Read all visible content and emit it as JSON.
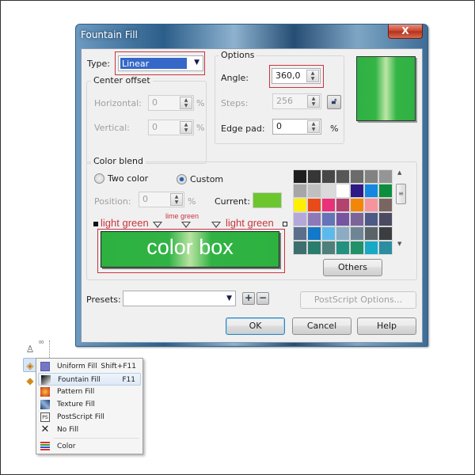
{
  "dialog": {
    "title": "Fountain Fill",
    "close_label": "X",
    "type": {
      "label": "Type:",
      "value": "Linear"
    },
    "center_offset": {
      "title": "Center offset",
      "horizontal": {
        "label": "Horizontal:",
        "value": "0",
        "unit": "%"
      },
      "vertical": {
        "label": "Vertical:",
        "value": "0",
        "unit": "%"
      }
    },
    "options": {
      "title": "Options",
      "angle": {
        "label": "Angle:",
        "value": "360,0"
      },
      "steps": {
        "label": "Steps:",
        "value": "256"
      },
      "edge_pad": {
        "label": "Edge pad:",
        "value": "0",
        "unit": "%"
      }
    },
    "color_blend": {
      "title": "Color blend",
      "two_color_label": "Two color",
      "custom_label": "Custom",
      "selected_mode": "Custom",
      "position": {
        "label": "Position:",
        "value": "0",
        "unit": "%"
      },
      "current_label": "Current:",
      "current_color": "#6cc72e",
      "annotations": {
        "left": "light green",
        "middle": "lime green",
        "right": "light green",
        "box": "color box"
      },
      "palette": [
        "#1e1e1e",
        "#363636",
        "#474747",
        "#575757",
        "#6b6b6b",
        "#828282",
        "#959595",
        "#a6a6a6",
        "#c0c0c0",
        "#dadada",
        "#ffffff",
        "#2e1a86",
        "#1487e0",
        "#0d8d3e",
        "#ffef00",
        "#e84a1a",
        "#e83178",
        "#b3426f",
        "#f28707",
        "#f5949c",
        "#7a6660",
        "#b3a8d9",
        "#8d79b8",
        "#6574b8",
        "#7654a0",
        "#7b6598",
        "#4e5a86",
        "#4c4a60",
        "#5b6f8c",
        "#1478c8",
        "#5db9ec",
        "#8cacc4",
        "#6f8595",
        "#5a6468",
        "#3a3e40",
        "#3f6e6e",
        "#2a7d6c",
        "#4e7f7b",
        "#239080",
        "#21916a",
        "#17a9c6",
        "#2a8ea0"
      ],
      "others_label": "Others"
    },
    "presets": {
      "label": "Presets:",
      "value": ""
    },
    "postscript_label": "PostScript Options...",
    "ok_label": "OK",
    "cancel_label": "Cancel",
    "help_label": "Help"
  },
  "flyout": {
    "items": [
      {
        "icon": "uniform-fill-icon",
        "label": "Uniform Fill",
        "shortcut": "Shift+F11"
      },
      {
        "icon": "fountain-fill-icon",
        "label": "Fountain Fill",
        "shortcut": "F11"
      },
      {
        "icon": "pattern-fill-icon",
        "label": "Pattern Fill",
        "shortcut": ""
      },
      {
        "icon": "texture-fill-icon",
        "label": "Texture Fill",
        "shortcut": ""
      },
      {
        "icon": "postscript-fill-icon",
        "label": "PostScript Fill",
        "shortcut": ""
      },
      {
        "icon": "no-fill-icon",
        "label": "No Fill",
        "shortcut": ""
      },
      {
        "icon": "color-icon",
        "label": "Color",
        "shortcut": ""
      }
    ],
    "highlighted": "Fountain Fill"
  }
}
